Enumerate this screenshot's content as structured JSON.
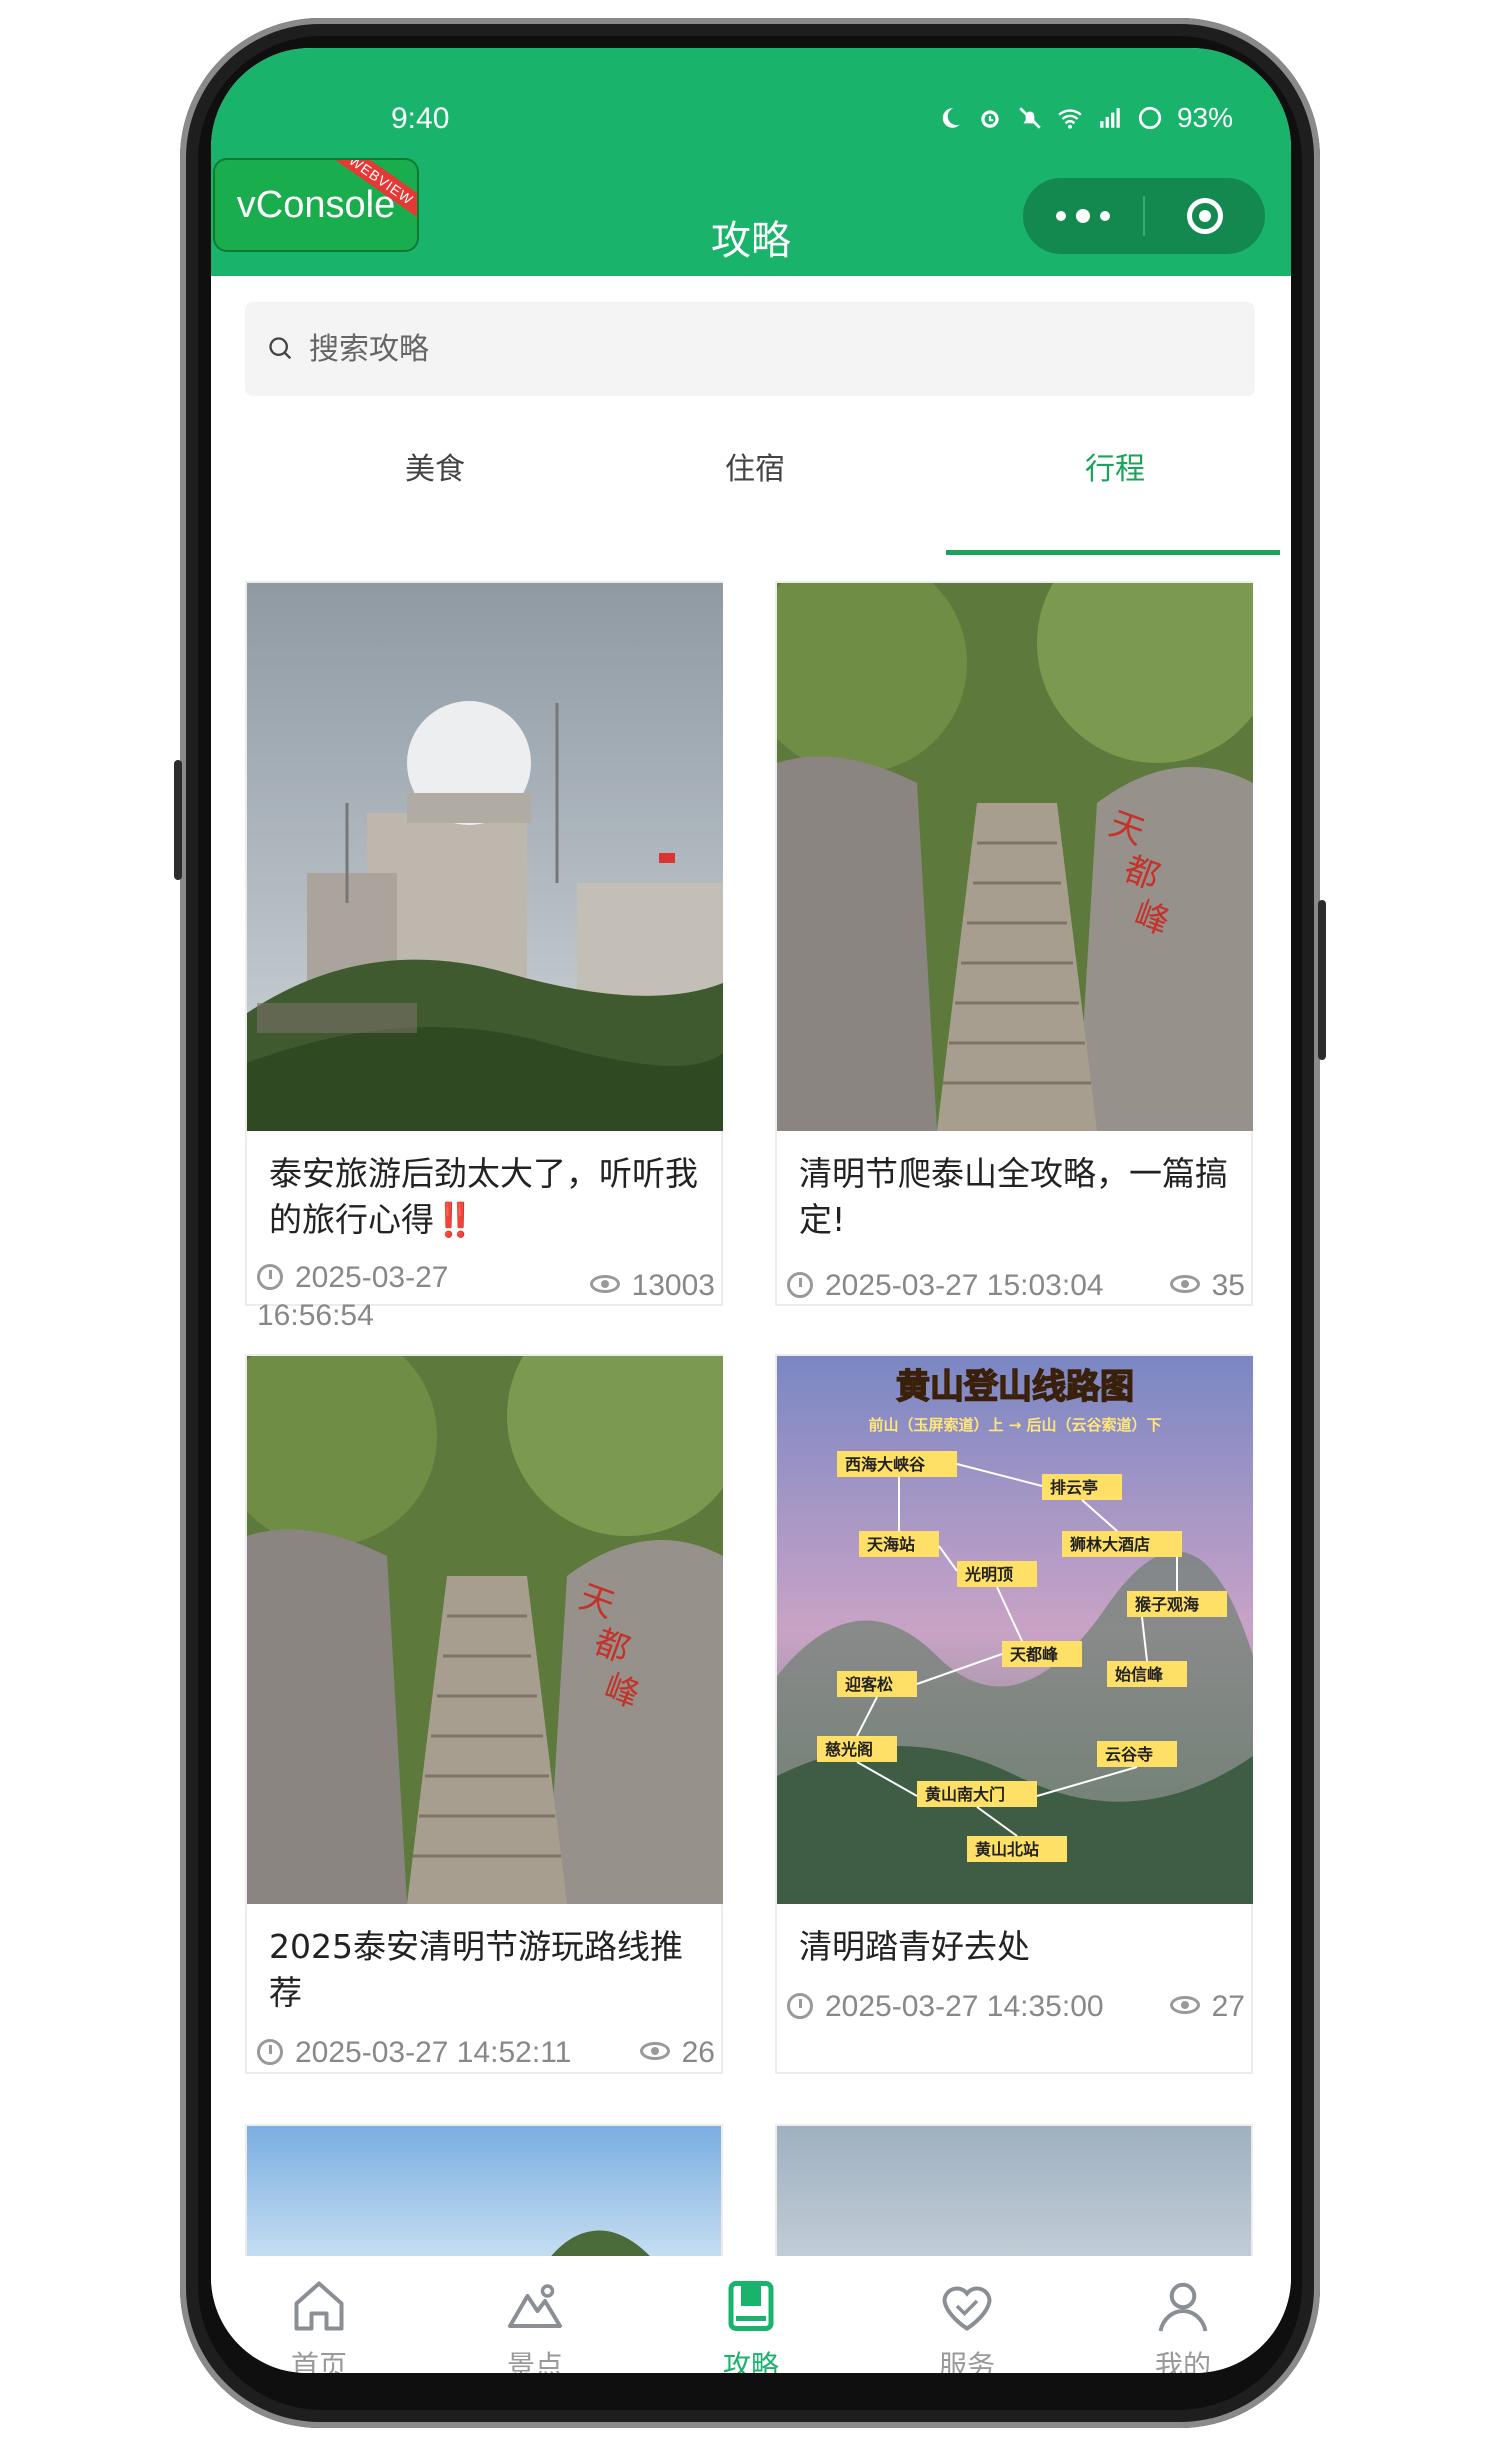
{
  "status_bar": {
    "time": "9:40",
    "battery": "93%"
  },
  "vconsole": {
    "label": "vConsole",
    "badge": "WEBVIEW"
  },
  "nav": {
    "title": "攻略"
  },
  "search": {
    "placeholder": "搜索攻略"
  },
  "tabs": [
    {
      "label": "美食",
      "active": false
    },
    {
      "label": "住宿",
      "active": false
    },
    {
      "label": "行程",
      "active": true
    }
  ],
  "cards": [
    {
      "title": "泰安旅游后劲太大了，听听我的旅行心得‼️",
      "date": "2025-03-27 16:56:54",
      "views": "13003"
    },
    {
      "title": "清明节爬泰山全攻略，一篇搞定!",
      "date": "2025-03-27 15:03:04",
      "views": "35"
    },
    {
      "title": "2025泰安清明节游玩路线推荐",
      "date": "2025-03-27 14:52:11",
      "views": "26"
    },
    {
      "title": "清明踏青好去处",
      "date": "2025-03-27 14:35:00",
      "views": "27"
    }
  ],
  "map_image_text": {
    "title": "黄山登山线路图",
    "subtitle": "前山（玉屏索道）上 → 后山（云谷索道）下"
  },
  "bottom_nav": [
    {
      "label": "首页",
      "icon": "home-icon",
      "active": false
    },
    {
      "label": "景点",
      "icon": "mountain-icon",
      "active": false
    },
    {
      "label": "攻略",
      "icon": "book-icon",
      "active": true
    },
    {
      "label": "服务",
      "icon": "heart-handshake-icon",
      "active": false
    },
    {
      "label": "我的",
      "icon": "user-icon",
      "active": false
    }
  ],
  "colors": {
    "brand": "#19b36b",
    "active_tab": "#1aa35a",
    "text": "#222222",
    "muted": "#888888"
  }
}
